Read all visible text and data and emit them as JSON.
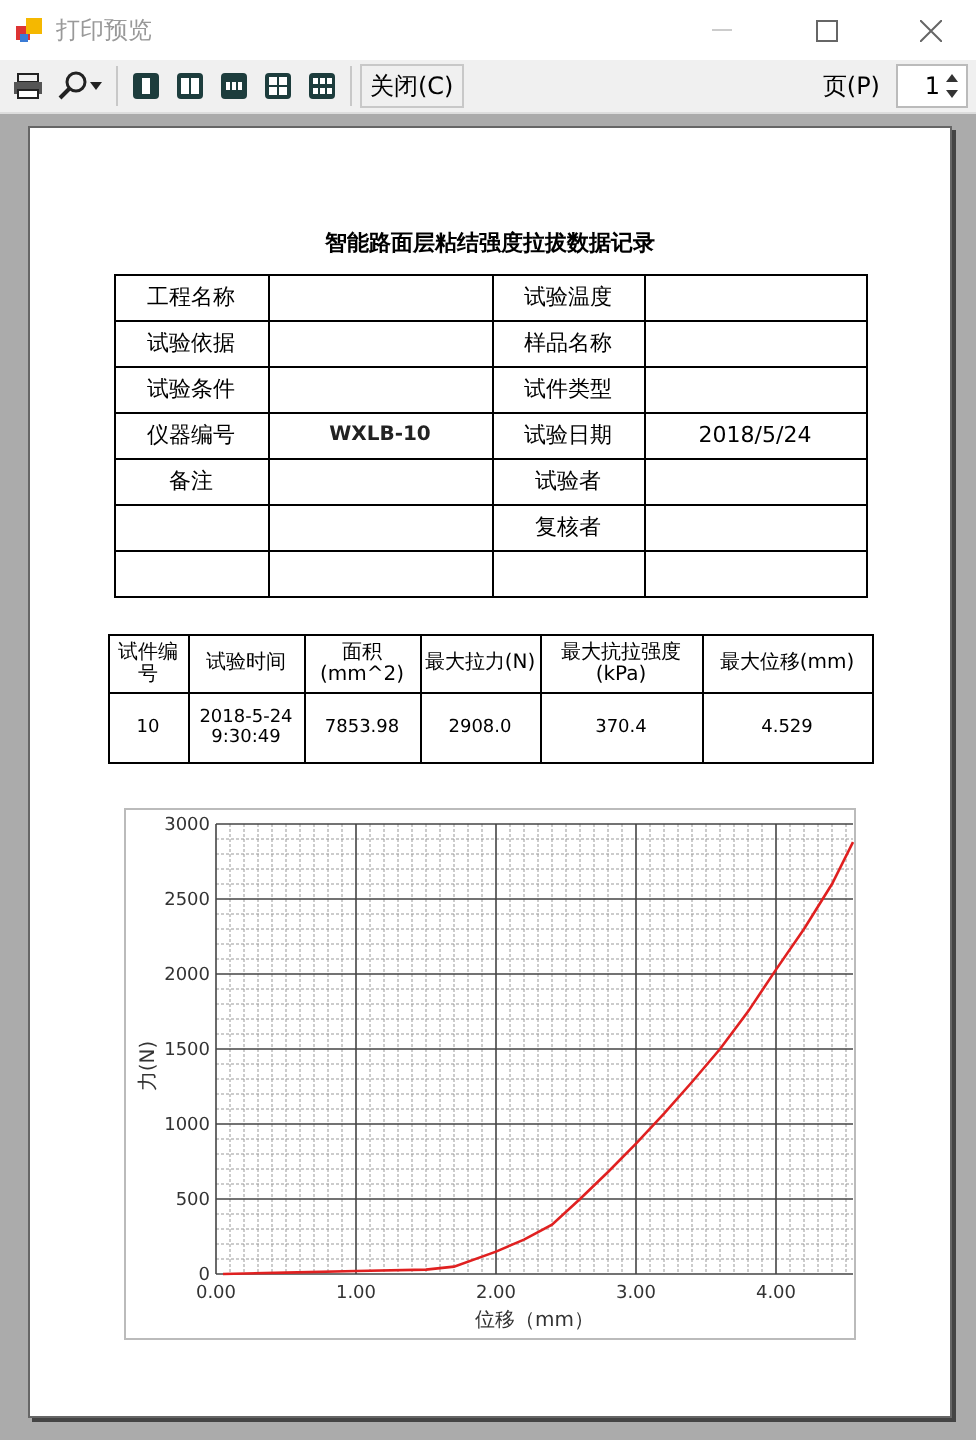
{
  "window": {
    "title": "打印预览"
  },
  "toolbar": {
    "close_button": "关闭(C)",
    "page_label": "页(P)",
    "page_value": "1"
  },
  "document": {
    "title": "智能路面层粘结强度拉拔数据记录",
    "info_table": {
      "rows": [
        {
          "label_1": "工程名称",
          "label_2": "试验温度"
        },
        {
          "label_1": "试验依据",
          "label_2": "样品名称"
        },
        {
          "label_1": "试验条件",
          "label_2": "试件类型"
        },
        {
          "label_1": "仪器编号",
          "value_1": "WXLB-10",
          "label_2": "试验日期",
          "value_2": "2018/5/24"
        },
        {
          "label_1": "备注",
          "label_2": "试验者"
        },
        {
          "label_2": "复核者"
        },
        {}
      ]
    },
    "results_table": {
      "columns": [
        "试件编号",
        "试验时间",
        "面积(mm^2)",
        "最大拉力(N)",
        "最大抗拉强度(kPa)",
        "最大位移(mm)"
      ],
      "rows": [
        [
          "10",
          "2018-5-24\n9:30:49",
          "7853.98",
          "2908.0",
          "370.4",
          "4.529"
        ]
      ]
    },
    "chart": {
      "chart_data": {
        "type": "line",
        "xlabel": "位移（mm）",
        "ylabel": "力(N)",
        "x": [
          0.05,
          0.5,
          1.0,
          1.5,
          1.7,
          2.0,
          2.2,
          2.4,
          2.6,
          2.8,
          3.0,
          3.2,
          3.4,
          3.6,
          3.8,
          4.0,
          4.2,
          4.4,
          4.55
        ],
        "grid": true,
        "series": [
          {
            "color": "#e02020",
            "values": [
              0,
              10,
              20,
              30,
              50,
              150,
              230,
              330,
              500,
              680,
              870,
              1070,
              1280,
              1500,
              1750,
              2030,
              2300,
              2600,
              2880
            ]
          }
        ],
        "xlim": [
          0,
          4.55
        ],
        "ylim": [
          0,
          3000
        ],
        "xticks": [
          {
            "value": 0,
            "label": "0.00"
          },
          {
            "value": 1,
            "label": "1.00"
          },
          {
            "value": 2,
            "label": "2.00"
          },
          {
            "value": 3,
            "label": "3.00"
          },
          {
            "value": 4,
            "label": "4.00"
          }
        ],
        "yticks": [
          0,
          500,
          1000,
          1500,
          2000,
          2500,
          3000
        ]
      }
    }
  }
}
